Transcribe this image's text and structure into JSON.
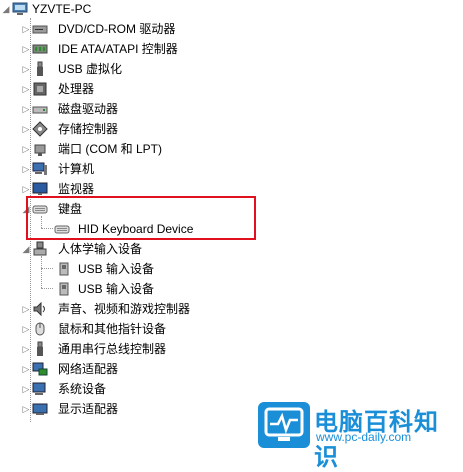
{
  "root": {
    "label": "YZVTE-PC"
  },
  "categories": [
    {
      "label": "DVD/CD-ROM 驱动器",
      "icon": "dvd-drive-icon"
    },
    {
      "label": "IDE ATA/ATAPI 控制器",
      "icon": "ide-controller-icon"
    },
    {
      "label": "USB 虚拟化",
      "icon": "usb-icon"
    },
    {
      "label": "处理器",
      "icon": "processor-icon"
    },
    {
      "label": "磁盘驱动器",
      "icon": "disk-drive-icon"
    },
    {
      "label": "存储控制器",
      "icon": "storage-controller-icon"
    },
    {
      "label": "端口 (COM 和 LPT)",
      "icon": "port-icon"
    },
    {
      "label": "计算机",
      "icon": "computer-icon"
    },
    {
      "label": "监视器",
      "icon": "monitor-icon"
    }
  ],
  "keyboard": {
    "label": "键盘",
    "child": "HID Keyboard Device"
  },
  "hid": {
    "label": "人体学输入设备",
    "children": [
      "USB 输入设备",
      "USB 输入设备"
    ]
  },
  "categories2": [
    {
      "label": "声音、视频和游戏控制器",
      "icon": "sound-icon"
    },
    {
      "label": "鼠标和其他指针设备",
      "icon": "mouse-icon"
    },
    {
      "label": "通用串行总线控制器",
      "icon": "usb-controller-icon"
    },
    {
      "label": "网络适配器",
      "icon": "network-adapter-icon"
    },
    {
      "label": "系统设备",
      "icon": "system-devices-icon"
    },
    {
      "label": "显示适配器",
      "icon": "display-adapter-icon"
    }
  ],
  "watermark": {
    "title": "电脑百科知识",
    "url": "www.pc-daily.com"
  }
}
